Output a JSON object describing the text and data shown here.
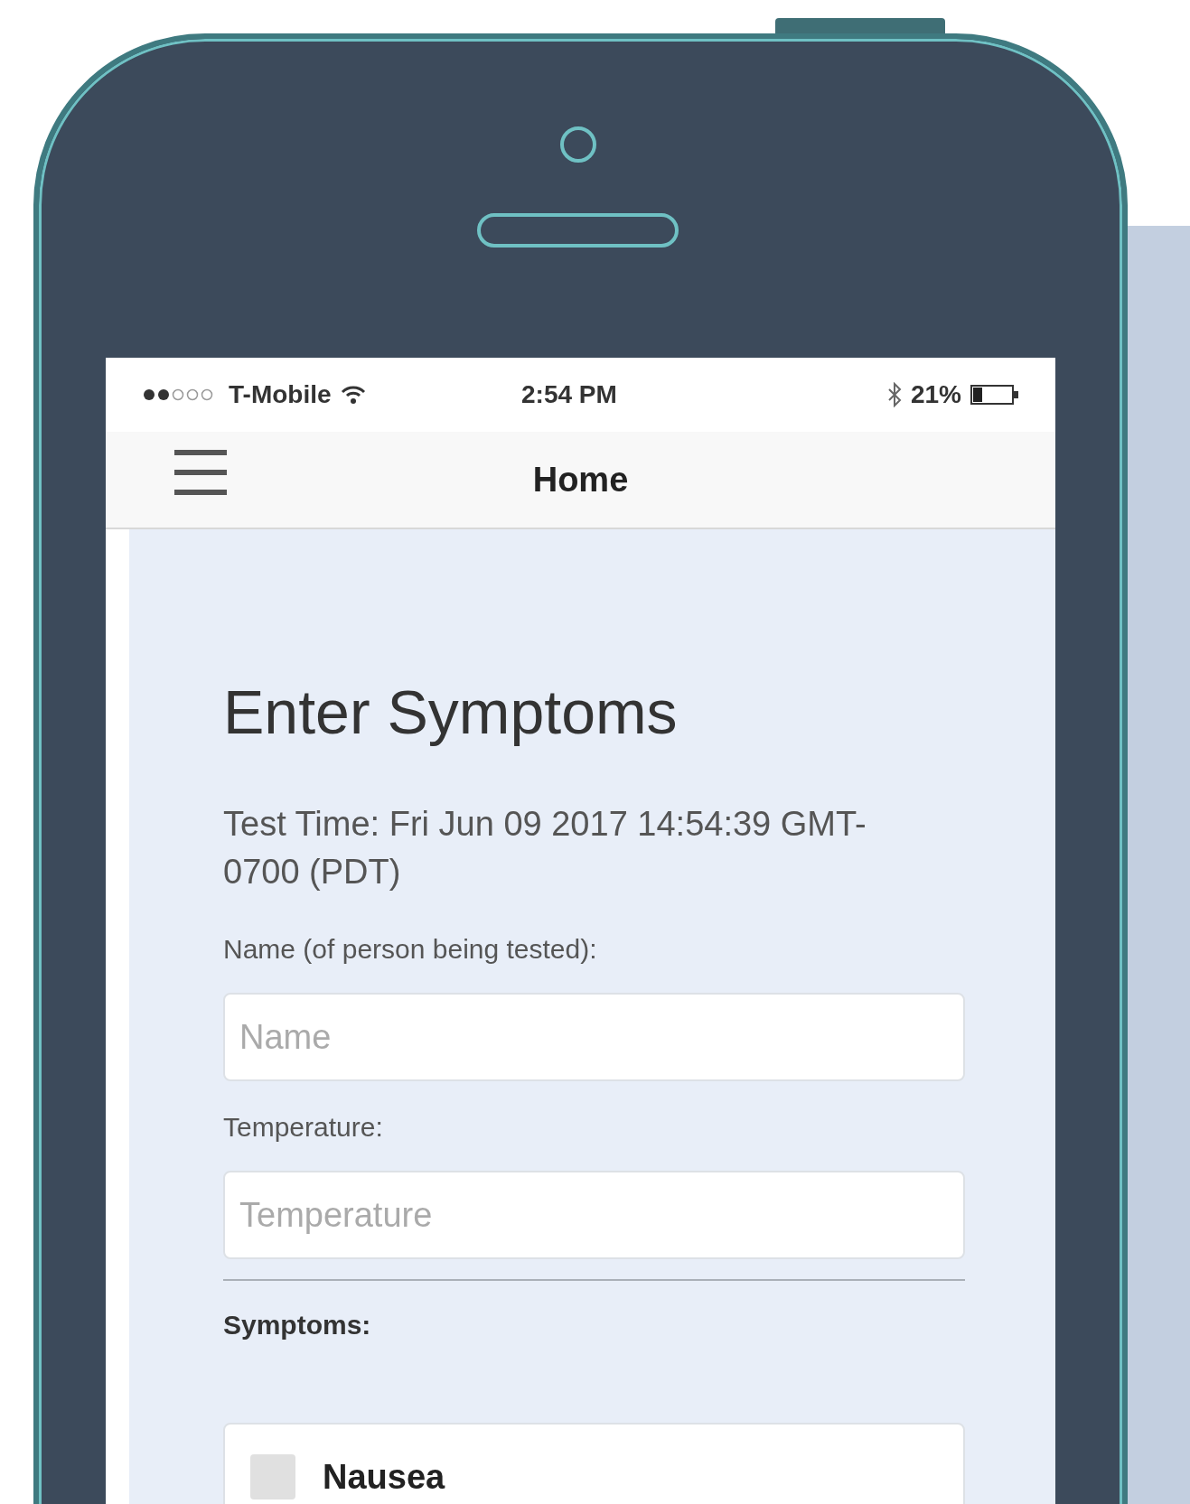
{
  "status_bar": {
    "carrier": "T-Mobile",
    "time": "2:54 PM",
    "battery": "21%"
  },
  "nav_bar": {
    "title": "Home"
  },
  "heading": "Enter Symptoms",
  "test_time": "Test Time: Fri Jun 09 2017 14:54:39 GMT-0700 (PDT)",
  "fields": [
    {
      "label": "Name (of person being tested):",
      "placeholder": "Name"
    },
    {
      "label": "Temperature:",
      "placeholder": "Temperature"
    }
  ],
  "section_title": "Symptoms:",
  "symptoms": [
    {
      "label": "Nausea",
      "checked": false
    }
  ]
}
